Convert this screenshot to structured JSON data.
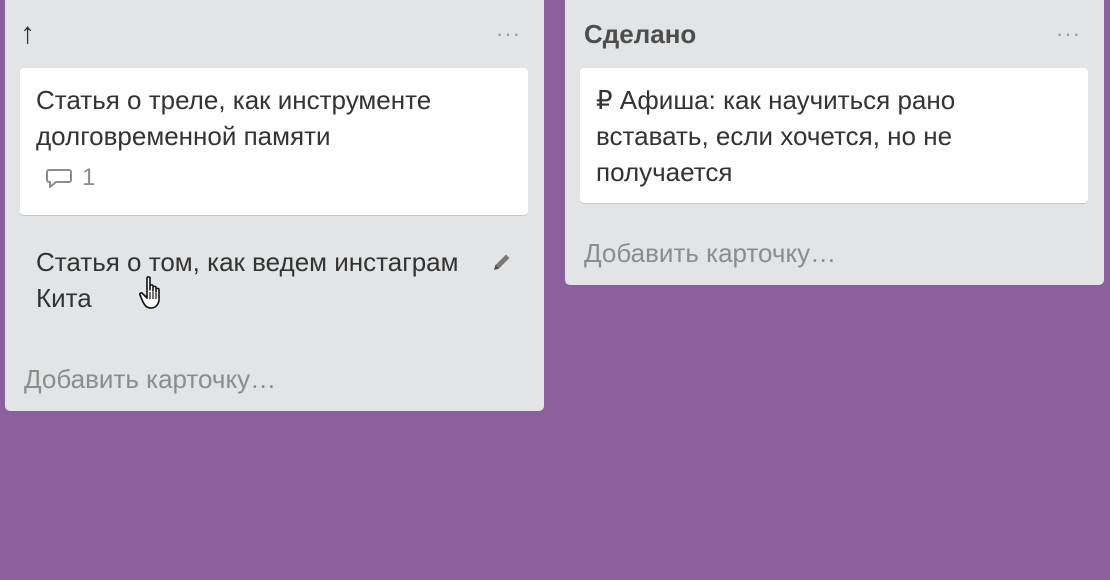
{
  "lists": [
    {
      "title": "↑",
      "menu_label": "···",
      "cards": [
        {
          "text": "Статья о треле, как инструменте долговременной памяти",
          "comment_count": "1",
          "badge_icon": "comment-icon"
        },
        {
          "text": "Статья о том, как ведем инстаграм Кита",
          "state": "hover",
          "action_icon": "pencil-icon"
        }
      ],
      "add_card_label": "Добавить карточку…"
    },
    {
      "title": "Сделано",
      "menu_label": "···",
      "cards": [
        {
          "text": "₽ Афиша: как научиться рано вставать, если хочется, но не получается"
        }
      ],
      "add_card_label": "Добавить карточку…"
    }
  ],
  "colors": {
    "board_background": "#8a609e",
    "list_background": "#e2e4e6",
    "card_background": "#ffffff",
    "muted_text": "#8c8c8c"
  }
}
